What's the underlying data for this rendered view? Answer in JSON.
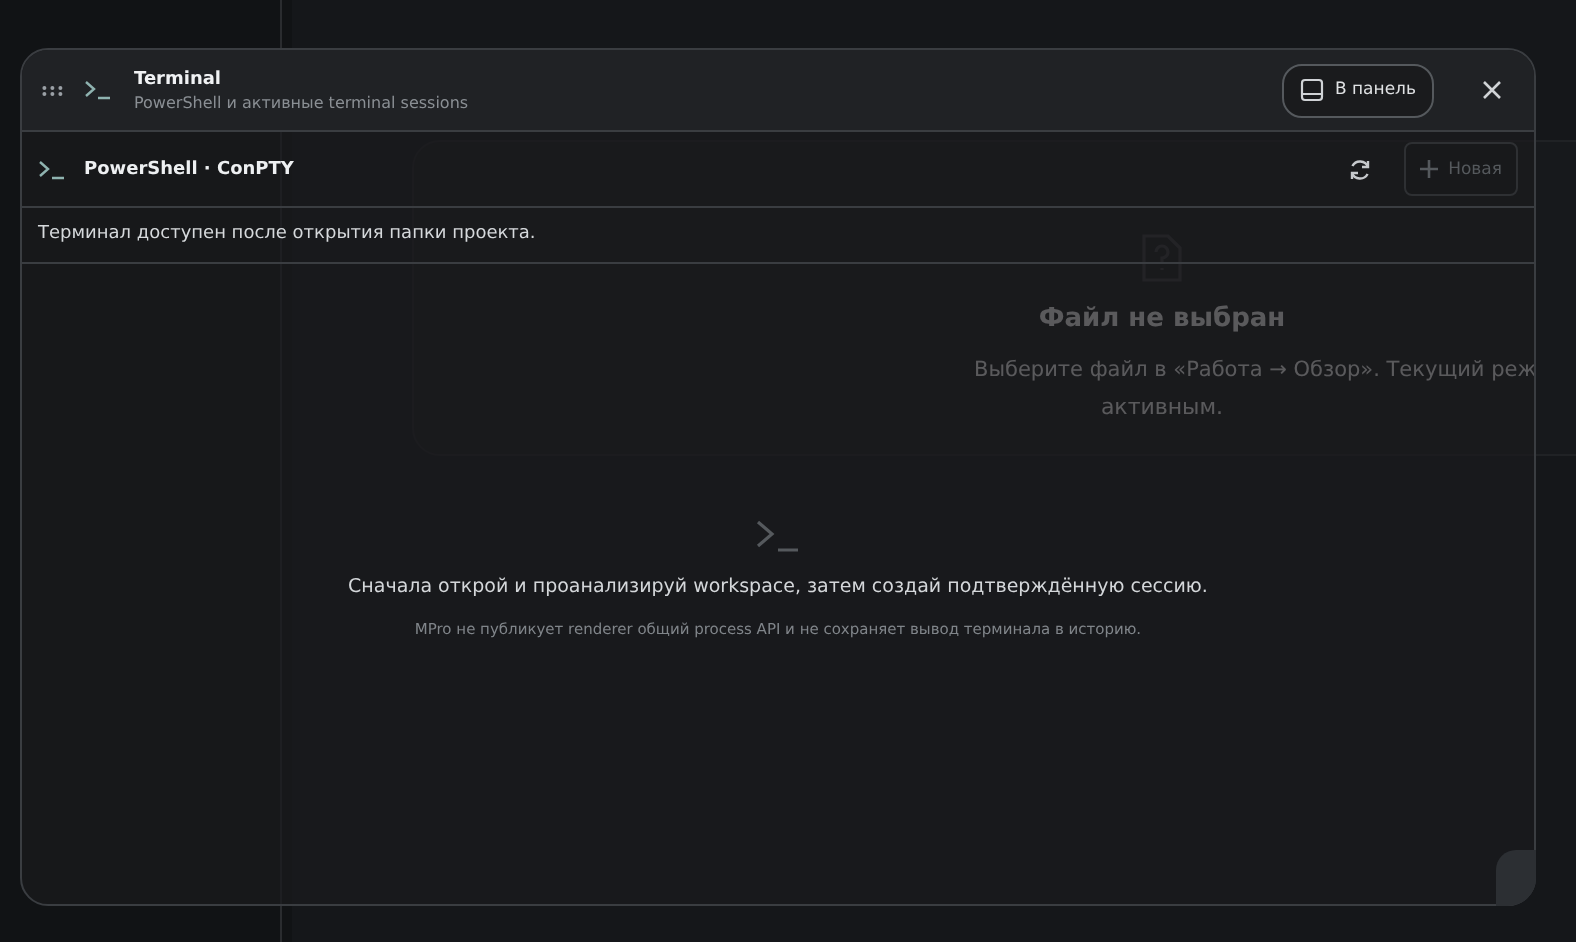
{
  "background": {
    "empty_title": "Файл не выбран",
    "empty_line_1": "Выберите файл в «Работа → Обзор». Текущий реж",
    "empty_line_2": "активным."
  },
  "window": {
    "title": "Terminal",
    "subtitle": "PowerShell и активные terminal sessions",
    "dock_button": "В панель"
  },
  "toolbar": {
    "session_title": "PowerShell · ConPTY",
    "new_button": {
      "label": "Новая",
      "disabled": true
    }
  },
  "notice": "Терминал доступен после открытия папки проекта.",
  "empty_state": {
    "message": "Сначала открой и проанализируй workspace, затем создай подтверждённую сессию.",
    "note": "MPro не публикует renderer общий process API и не сохраняет вывод терминала в историю."
  }
}
